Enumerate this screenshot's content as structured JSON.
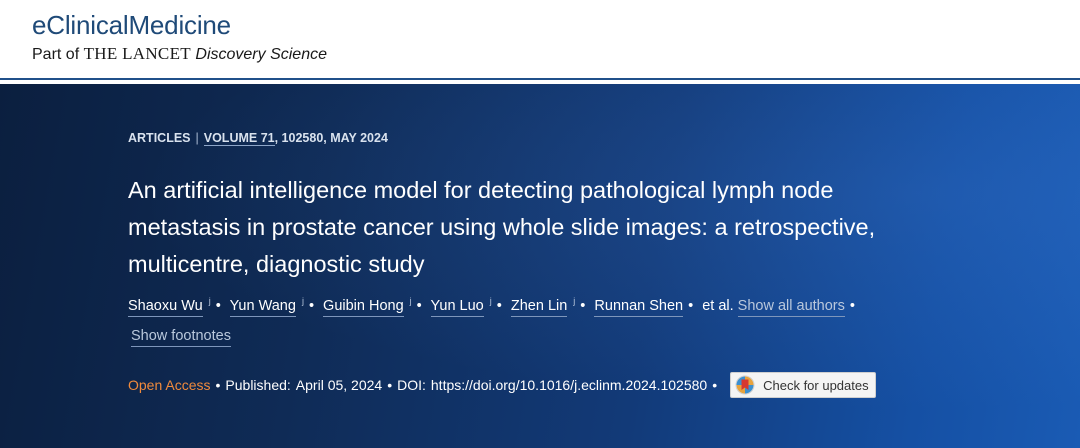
{
  "header": {
    "journal_name": "eClinicalMedicine",
    "part_of": "Part of",
    "lancet": "THE LANCET",
    "discovery": "Discovery Science"
  },
  "article": {
    "type_label": "ARTICLES",
    "volume": "VOLUME 71",
    "volume_rest": ", 102580, MAY 2024",
    "title": "An artificial intelligence model for detecting pathological lymph node metastasis in prostate cancer using whole slide images: a retrospective, multicentre, diagnostic study"
  },
  "authors": {
    "list": [
      "Shaoxu Wu",
      "Yun Wang",
      "Guibin Hong",
      "Yun Luo",
      "Zhen Lin",
      "Runnan Shen"
    ],
    "marker": "j",
    "et_al": "et al.",
    "show_all": "Show all authors",
    "show_footnotes": "Show footnotes"
  },
  "publication": {
    "open_access": "Open Access",
    "published_label": "Published:",
    "published_date": "April 05, 2024",
    "doi_label": "DOI:",
    "doi_url": "https://doi.org/10.1016/j.eclinm.2024.102580",
    "check_updates": "Check for updates"
  },
  "colors": {
    "journal_blue": "#1f4a78",
    "hero_dark": "#0b1f3f",
    "hero_light": "#1a5bb4",
    "open_access_orange": "#f08a3c"
  }
}
